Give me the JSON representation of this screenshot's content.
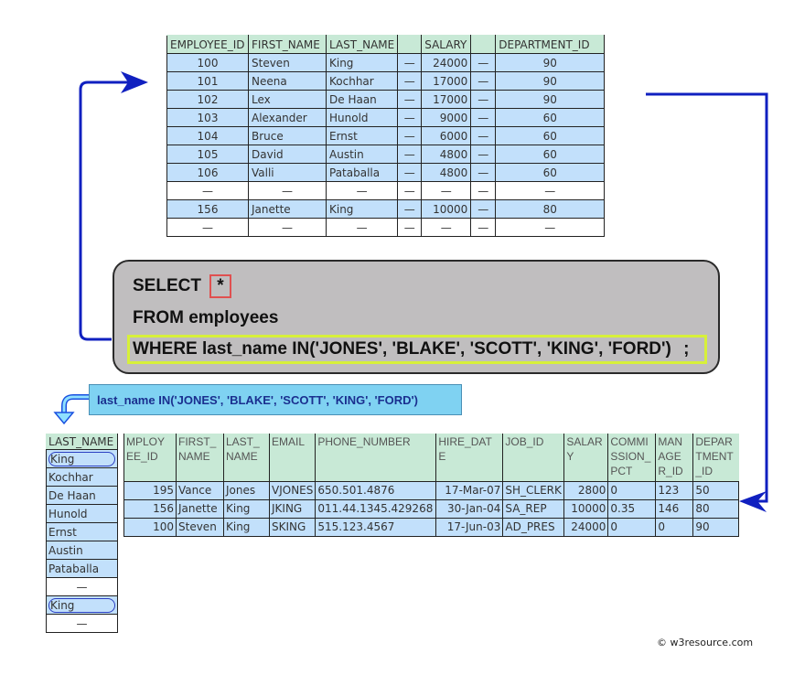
{
  "top_table": {
    "headers": [
      "EMPLOYEE_ID",
      "FIRST_NAME",
      "LAST_NAME",
      "",
      "SALARY",
      "",
      "DEPARTMENT_ID"
    ],
    "rows": [
      {
        "id": "100",
        "first": "Steven",
        "last": "King",
        "g1": "—",
        "salary": "24000",
        "g2": "—",
        "dept": "90",
        "highlight": true
      },
      {
        "id": "101",
        "first": "Neena",
        "last": "Kochhar",
        "g1": "—",
        "salary": "17000",
        "g2": "—",
        "dept": "90",
        "highlight": true
      },
      {
        "id": "102",
        "first": "Lex",
        "last": "De Haan",
        "g1": "—",
        "salary": "17000",
        "g2": "—",
        "dept": "90",
        "highlight": true
      },
      {
        "id": "103",
        "first": "Alexander",
        "last": "Hunold",
        "g1": "—",
        "salary": "9000",
        "g2": "—",
        "dept": "60",
        "highlight": true
      },
      {
        "id": "104",
        "first": "Bruce",
        "last": "Ernst",
        "g1": "—",
        "salary": "6000",
        "g2": "—",
        "dept": "60",
        "highlight": true
      },
      {
        "id": "105",
        "first": "David",
        "last": "Austin",
        "g1": "—",
        "salary": "4800",
        "g2": "—",
        "dept": "60",
        "highlight": true
      },
      {
        "id": "106",
        "first": "Valli",
        "last": "Pataballa",
        "g1": "—",
        "salary": "4800",
        "g2": "—",
        "dept": "60",
        "highlight": true
      },
      {
        "id": "—",
        "first": "—",
        "last": "—",
        "g1": "—",
        "salary": "—",
        "g2": "—",
        "dept": "—",
        "highlight": false
      },
      {
        "id": "156",
        "first": "Janette",
        "last": "King",
        "g1": "—",
        "salary": "10000",
        "g2": "—",
        "dept": "80",
        "highlight": true
      },
      {
        "id": "—",
        "first": "—",
        "last": "—",
        "g1": "—",
        "salary": "—",
        "g2": "—",
        "dept": "—",
        "highlight": false
      }
    ]
  },
  "sql": {
    "select": "SELECT",
    "star": "*",
    "from": "FROM employees",
    "where": "WHERE last_name IN('JONES', 'BLAKE', 'SCOTT', 'KING', 'FORD')",
    "semicolon": ";"
  },
  "callout": {
    "text": "last_name IN('JONES', 'BLAKE', 'SCOTT', 'KING', 'FORD')"
  },
  "last_name_column": {
    "header": "LAST_NAME",
    "rows": [
      {
        "value": "King",
        "matched": true,
        "highlight": true
      },
      {
        "value": "Kochhar",
        "matched": false,
        "highlight": true
      },
      {
        "value": "De Haan",
        "matched": false,
        "highlight": true
      },
      {
        "value": "Hunold",
        "matched": false,
        "highlight": true
      },
      {
        "value": "Ernst",
        "matched": false,
        "highlight": true
      },
      {
        "value": "Austin",
        "matched": false,
        "highlight": true
      },
      {
        "value": "Pataballa",
        "matched": false,
        "highlight": true
      },
      {
        "value": "—",
        "matched": false,
        "highlight": false
      },
      {
        "value": "King",
        "matched": true,
        "highlight": true
      },
      {
        "value": "—",
        "matched": false,
        "highlight": false
      }
    ]
  },
  "result_table": {
    "headers": [
      "MPLOY EE_ID",
      "FIRST_ NAME",
      "LAST_ NAME",
      "EMAIL",
      "PHONE_NUMBER",
      "HIRE_DAT E",
      "JOB_ID",
      "SALAR Y",
      "COMMI SSION_ PCT",
      "MAN AGE R_ID",
      "DEPAR TMENT _ID"
    ],
    "rows": [
      [
        "195",
        "Vance",
        "Jones",
        "VJONES",
        "650.501.4876",
        "17-Mar-07",
        "SH_CLERK",
        "2800",
        "0",
        "123",
        "50"
      ],
      [
        "156",
        "Janette",
        "King",
        "JKING",
        "011.44.1345.429268",
        "30-Jan-04",
        "SA_REP",
        "10000",
        "0.35",
        "146",
        "80"
      ],
      [
        "100",
        "Steven",
        "King",
        "SKING",
        "515.123.4567",
        "17-Jun-03",
        "AD_PRES",
        "24000",
        "0",
        "0",
        "90"
      ]
    ]
  },
  "footer": {
    "copyright": "© w3resource.com"
  },
  "colors": {
    "arrow": "#1020c0",
    "header_bg": "#c8e9d6",
    "row_bg": "#c2e0fb",
    "sql_box_bg": "#c0bebf",
    "star_border": "#e05050",
    "where_border": "#d7f03a",
    "callout_bg": "#7fd2f2"
  }
}
